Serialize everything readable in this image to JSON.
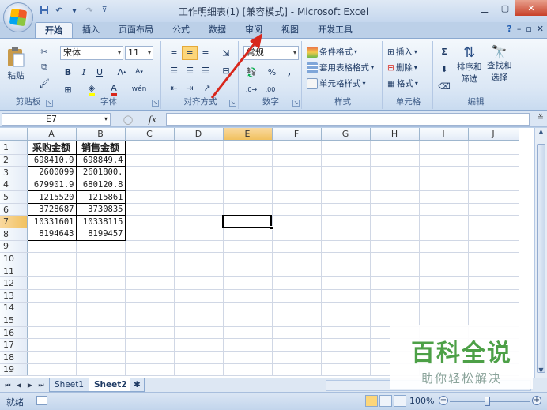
{
  "window": {
    "title": "工作明细表(1)  [兼容模式] - Microsoft Excel"
  },
  "ribbon": {
    "tabs": [
      "开始",
      "插入",
      "页面布局",
      "公式",
      "数据",
      "审阅",
      "视图",
      "开发工具"
    ],
    "active_tab": "开始",
    "groups": {
      "clipboard": {
        "label": "剪贴板",
        "paste": "粘贴"
      },
      "font": {
        "label": "字体",
        "font_name": "宋体",
        "font_size": "11"
      },
      "alignment": {
        "label": "对齐方式"
      },
      "number": {
        "label": "数字",
        "format": "常规",
        "percent": "%",
        "comma": ","
      },
      "styles": {
        "label": "样式",
        "conditional": "条件格式",
        "table": "套用表格格式",
        "cell_styles": "单元格样式"
      },
      "cells": {
        "label": "单元格",
        "insert": "插入",
        "delete": "删除",
        "format": "格式"
      },
      "editing": {
        "label": "编辑",
        "sort_filter": "排序和\n筛选",
        "sort": "排序和",
        "filter": "筛选",
        "find": "查找和",
        "select": "选择"
      }
    }
  },
  "formula_bar": {
    "name_box": "E7",
    "fx": "fx",
    "formula": ""
  },
  "grid": {
    "columns": [
      "A",
      "B",
      "C",
      "D",
      "E",
      "F",
      "G",
      "H",
      "I",
      "J"
    ],
    "selected_column": "E",
    "selected_row": 7,
    "rows": [
      [
        "采购金额",
        "销售金额"
      ],
      [
        "698410.9",
        "698849.4"
      ],
      [
        "2600099",
        "2601800."
      ],
      [
        "679901.9",
        "680120.8"
      ],
      [
        "1215520",
        "1215861"
      ],
      [
        "3728687",
        "3730835"
      ],
      [
        "10331601",
        "10338115"
      ],
      [
        "8194643",
        "8199457"
      ]
    ],
    "row_numbers": [
      "1",
      "2",
      "3",
      "4",
      "5",
      "6",
      "7",
      "8",
      "9",
      "10",
      "11",
      "12",
      "13",
      "14",
      "15",
      "16",
      "17",
      "18",
      "19"
    ]
  },
  "sheets": {
    "tabs": [
      "Sheet1",
      "Sheet2"
    ],
    "active": "Sheet2"
  },
  "status": {
    "ready": "就绪",
    "zoom": "100%"
  },
  "watermark": {
    "title": "百科全说",
    "subtitle": "助你轻松解决"
  },
  "colors": {
    "accent": "#d8271c",
    "selected_header": "#f1c15f",
    "watermark_green": "#4da047"
  }
}
